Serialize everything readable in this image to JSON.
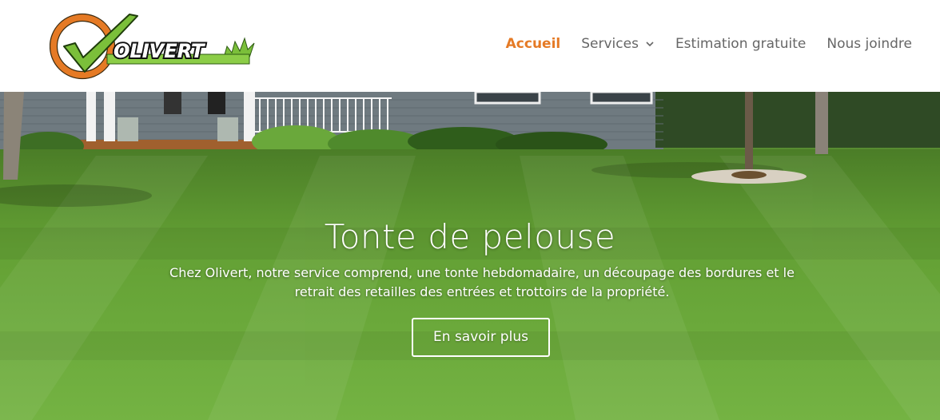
{
  "brand": {
    "logo_text": "OLIVERT",
    "colors": {
      "orange": "#e57a25",
      "green": "#7bbf3a",
      "dark": "#222222"
    }
  },
  "nav": {
    "items": [
      {
        "label": "Accueil",
        "active": true
      },
      {
        "label": "Services",
        "has_dropdown": true
      },
      {
        "label": "Estimation gratuite"
      },
      {
        "label": "Nous joindre"
      }
    ],
    "active_color": "#e57a25",
    "text_color": "#666666"
  },
  "hero": {
    "title": "Tonte de pelouse",
    "description_line1": "Chez Olivert, notre service comprend, une tonte hebdomadaire, un découpage des bordures et le",
    "description_line2": "retrait des retailles des entrées et trottoirs de la propriété.",
    "button_label": "En savoir plus"
  }
}
